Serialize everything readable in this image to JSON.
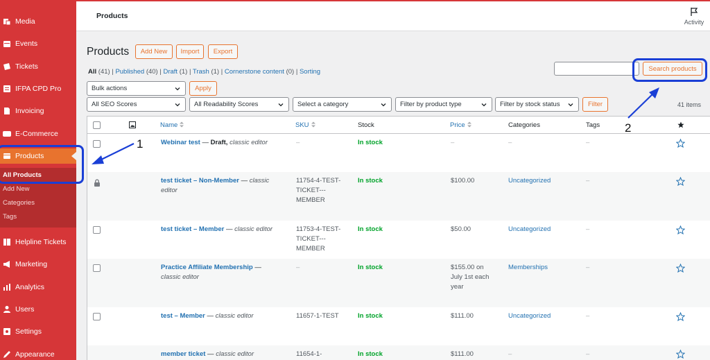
{
  "sidebar": {
    "items": [
      {
        "label": "Media",
        "icon": "media-icon"
      },
      {
        "label": "Events",
        "icon": "events-icon"
      },
      {
        "label": "Tickets",
        "icon": "tickets-icon"
      },
      {
        "label": "IFPA CPD Pro",
        "icon": "cpd-icon"
      },
      {
        "label": "Invoicing",
        "icon": "invoicing-icon"
      },
      {
        "label": "E-Commerce",
        "icon": "ecommerce-icon"
      },
      {
        "label": "Products",
        "icon": "products-icon"
      },
      {
        "label": "Helpline Tickets",
        "icon": "helpline-icon"
      },
      {
        "label": "Marketing",
        "icon": "marketing-icon"
      },
      {
        "label": "Analytics",
        "icon": "analytics-icon"
      },
      {
        "label": "Users",
        "icon": "users-icon"
      },
      {
        "label": "Settings",
        "icon": "settings-icon"
      },
      {
        "label": "Appearance",
        "icon": "appearance-icon"
      }
    ],
    "submenu": [
      "All Products",
      "Add New",
      "Categories",
      "Tags"
    ]
  },
  "topbar": {
    "title": "Products",
    "activity_label": "Activity"
  },
  "heading": {
    "title": "Products",
    "add_new": "Add New",
    "import": "Import",
    "export": "Export"
  },
  "views": {
    "all": "All",
    "all_count": "(41)",
    "published": "Published",
    "published_count": "(40)",
    "draft": "Draft",
    "draft_count": "(1)",
    "trash": "Trash",
    "trash_count": "(1)",
    "cornerstone": "Cornerstone content",
    "cornerstone_count": "(0)",
    "sorting": "Sorting",
    "sep": "|"
  },
  "search": {
    "button": "Search products",
    "value": ""
  },
  "filters": {
    "bulk_actions": "Bulk actions",
    "apply": "Apply",
    "seo": "All SEO Scores",
    "readability": "All Readability Scores",
    "category": "Select a category",
    "product_type": "Filter by product type",
    "stock_status": "Filter by stock status",
    "filter": "Filter",
    "items_count": "41 items"
  },
  "table": {
    "columns": {
      "name": "Name",
      "sku": "SKU",
      "stock": "Stock",
      "price": "Price",
      "categories": "Categories",
      "tags": "Tags"
    },
    "rows": [
      {
        "name": "Webinar test",
        "status": "Draft,",
        "meta": "classic editor",
        "sku": [
          "–"
        ],
        "stock": "In stock",
        "price": [
          "–"
        ],
        "category": "–",
        "tags": "–"
      },
      {
        "name": "test ticket – Non-Member",
        "meta_line1": "classic",
        "meta_line2": "editor",
        "sku": [
          "11754-4-TEST-",
          "TICKET---",
          "MEMBER"
        ],
        "stock": "In stock",
        "price": [
          "$100.00"
        ],
        "category": "Uncategorized",
        "tags": "–"
      },
      {
        "name": "test ticket – Member",
        "meta": "classic editor",
        "sku": [
          "11753-4-TEST-",
          "TICKET---",
          "MEMBER"
        ],
        "stock": "In stock",
        "price": [
          "$50.00"
        ],
        "category": "Uncategorized",
        "tags": "–"
      },
      {
        "name": "Practice Affiliate Membership",
        "meta": "classic editor",
        "sku": [
          "–"
        ],
        "stock": "In stock",
        "price": [
          "$155.00 on",
          "July 1st each",
          "year"
        ],
        "category": "Memberships",
        "tags": "–"
      },
      {
        "name": "test – Member",
        "meta": "classic editor",
        "sku": [
          "11657-1-TEST"
        ],
        "stock": "In stock",
        "price": [
          "$111.00"
        ],
        "category": "Uncategorized",
        "tags": "–"
      },
      {
        "name": "member ticket",
        "meta": "classic editor",
        "sku": [
          "11654-1-"
        ],
        "stock": "In stock",
        "price": [
          "$111.00"
        ],
        "category": "–",
        "tags": "–"
      }
    ]
  },
  "annotations": {
    "one": "1",
    "two": "2",
    "color": "#1a3fd6"
  },
  "colors": {
    "sidebar": "#d63638",
    "accent": "#e8732e",
    "link": "#2271b1",
    "in_stock": "#00a32a"
  }
}
